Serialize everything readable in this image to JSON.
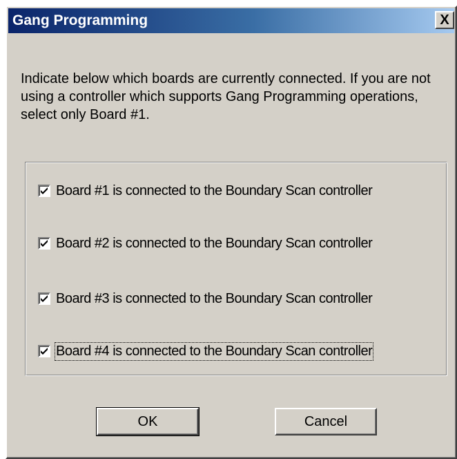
{
  "window": {
    "title": "Gang Programming",
    "close_glyph": "X"
  },
  "instructions": "Indicate below which boards are currently connected.  If you are not using a controller which supports Gang Programming operations, select only Board #1.",
  "boards": [
    {
      "label": "Board #1 is connected to the Boundary Scan controller",
      "checked": true
    },
    {
      "label": "Board #2 is connected to the Boundary Scan controller",
      "checked": true
    },
    {
      "label": "Board #3 is connected to the Boundary Scan controller",
      "checked": true
    },
    {
      "label": "Board #4 is connected to the Boundary Scan controller",
      "checked": true
    }
  ],
  "buttons": {
    "ok_label": "OK",
    "cancel_label": "Cancel"
  },
  "colors": {
    "dialog_bg": "#d4d0c8",
    "title_start": "#0a246a",
    "title_end": "#a6caf0"
  }
}
